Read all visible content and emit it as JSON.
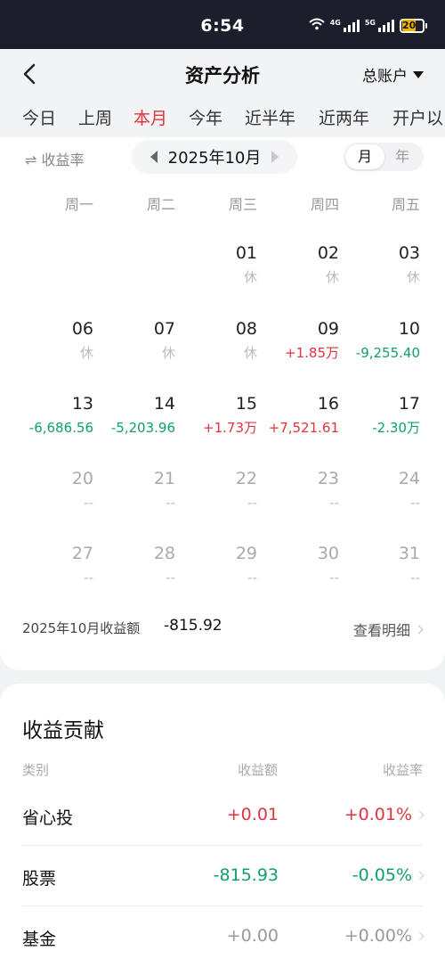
{
  "status_bar": {
    "time": "6:54",
    "signal1_label": "4G",
    "signal2_label": "5G",
    "battery": "20",
    "icons": [
      "wifi-icon",
      "signal-icon",
      "signal-icon",
      "battery-icon"
    ]
  },
  "header": {
    "title": "资产分析",
    "account": "总账户",
    "back_icon": "chevron-left-icon",
    "account_icon": "triangle-down-icon"
  },
  "tabs": [
    {
      "label": "今日"
    },
    {
      "label": "上周"
    },
    {
      "label": "本月",
      "active": true
    },
    {
      "label": "今年"
    },
    {
      "label": "近半年"
    },
    {
      "label": "近两年"
    },
    {
      "label": "开户以"
    }
  ],
  "calendar_controls": {
    "rate_toggle": "⇌ 收益率",
    "month": "2025年10月",
    "period_month": "月",
    "period_year": "年"
  },
  "weekdays": [
    "周一",
    "周二",
    "周三",
    "周四",
    "周五"
  ],
  "calendar": [
    {
      "day": "01",
      "value": "休",
      "status": "rest"
    },
    {
      "day": "02",
      "value": "休",
      "status": "rest"
    },
    {
      "day": "03",
      "value": "休",
      "status": "rest"
    },
    {
      "day": "06",
      "value": "休",
      "status": "rest"
    },
    {
      "day": "07",
      "value": "休",
      "status": "rest"
    },
    {
      "day": "08",
      "value": "休",
      "status": "rest"
    },
    {
      "day": "09",
      "value": "+1.85万",
      "status": "up"
    },
    {
      "day": "10",
      "value": "-9,255.40",
      "status": "down"
    },
    {
      "day": "13",
      "value": "-6,686.56",
      "status": "down"
    },
    {
      "day": "14",
      "value": "-5,203.96",
      "status": "down"
    },
    {
      "day": "15",
      "value": "+1.73万",
      "status": "up"
    },
    {
      "day": "16",
      "value": "+7,521.61",
      "status": "up"
    },
    {
      "day": "17",
      "value": "-2.30万",
      "status": "down"
    },
    {
      "day": "20",
      "value": "--",
      "status": "future"
    },
    {
      "day": "21",
      "value": "--",
      "status": "future"
    },
    {
      "day": "22",
      "value": "--",
      "status": "future"
    },
    {
      "day": "23",
      "value": "--",
      "status": "future"
    },
    {
      "day": "24",
      "value": "--",
      "status": "future"
    },
    {
      "day": "27",
      "value": "--",
      "status": "future"
    },
    {
      "day": "28",
      "value": "--",
      "status": "future"
    },
    {
      "day": "29",
      "value": "--",
      "status": "future"
    },
    {
      "day": "30",
      "value": "--",
      "status": "future"
    },
    {
      "day": "31",
      "value": "--",
      "status": "future"
    }
  ],
  "summary": {
    "label": "2025年10月收益额",
    "value": "-815.92",
    "detail_link": "查看明细"
  },
  "contribution": {
    "title": "收益贡献",
    "headers": {
      "category": "类别",
      "amount": "收益额",
      "rate": "收益率"
    },
    "rows": [
      {
        "name": "省心投",
        "amount": "+0.01",
        "rate": "+0.01%",
        "trend": "up"
      },
      {
        "name": "股票",
        "amount": "-815.93",
        "rate": "-0.05%",
        "trend": "down"
      },
      {
        "name": "基金",
        "amount": "+0.00",
        "rate": "+0.00%",
        "trend": "flat"
      }
    ]
  },
  "colors": {
    "up": "#e0333f",
    "down": "#12a164",
    "accent": "#e0333f",
    "status_bar": "#1c1f2b"
  }
}
